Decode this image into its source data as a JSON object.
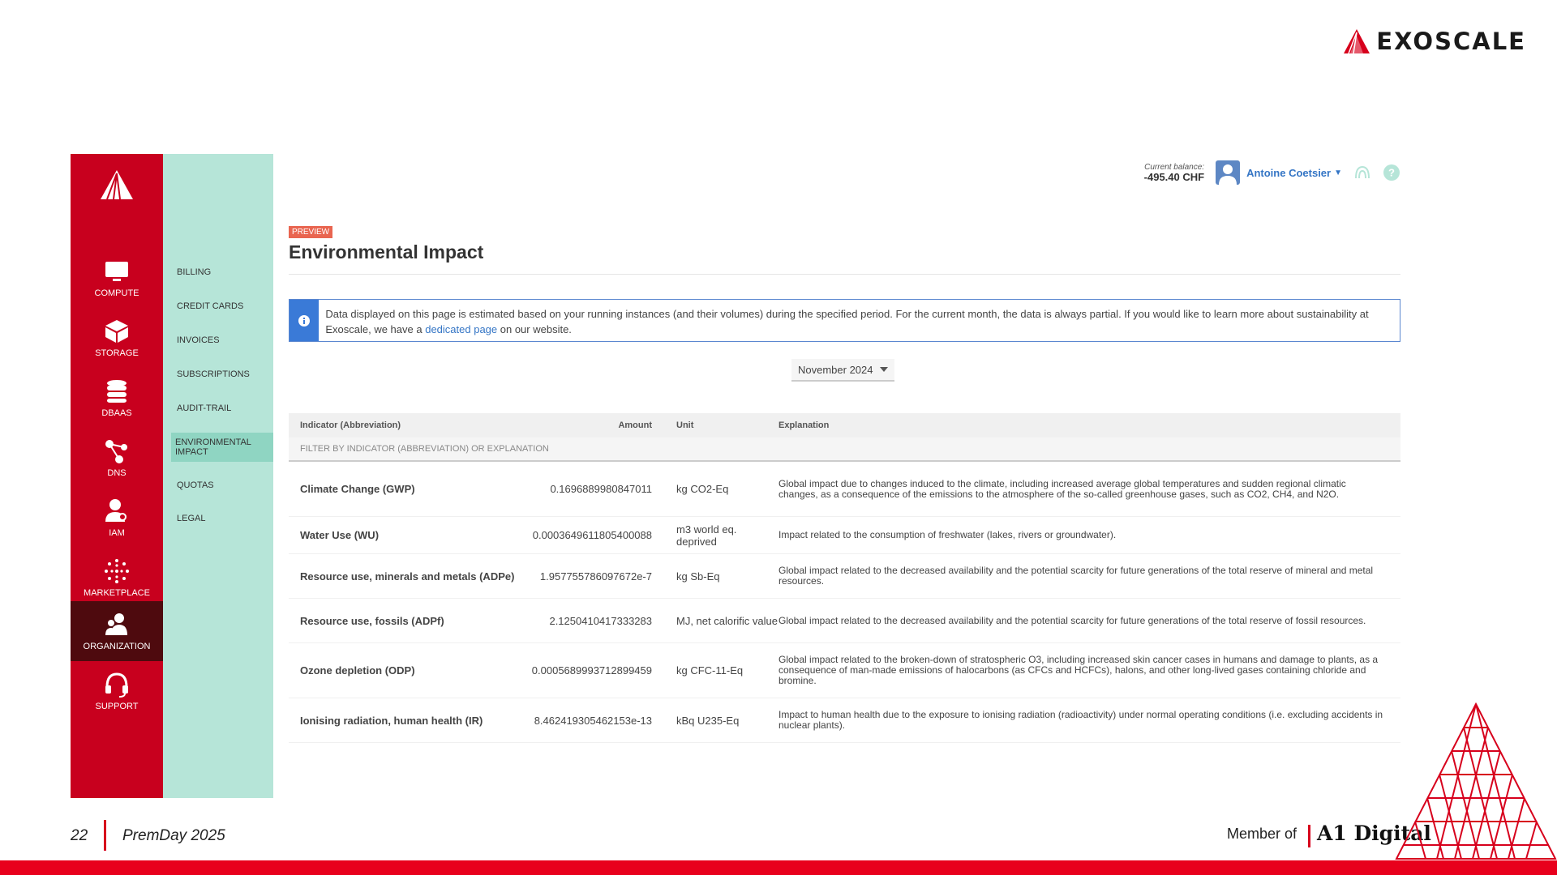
{
  "brand": {
    "name": "EXOSCALE"
  },
  "rail": {
    "items": [
      {
        "label": "COMPUTE",
        "icon": "monitor-icon"
      },
      {
        "label": "STORAGE",
        "icon": "cube-icon"
      },
      {
        "label": "DBAAS",
        "icon": "database-icon"
      },
      {
        "label": "DNS",
        "icon": "network-icon"
      },
      {
        "label": "IAM",
        "icon": "user-key-icon"
      },
      {
        "label": "MARKETPLACE",
        "icon": "dots-ring-icon"
      },
      {
        "label": "ORGANIZATION",
        "icon": "people-icon"
      },
      {
        "label": "SUPPORT",
        "icon": "headset-icon"
      }
    ],
    "active": "ORGANIZATION"
  },
  "subnav": {
    "items": [
      {
        "label": "BILLING"
      },
      {
        "label": "CREDIT CARDS"
      },
      {
        "label": "INVOICES"
      },
      {
        "label": "SUBSCRIPTIONS"
      },
      {
        "label": "AUDIT-TRAIL"
      },
      {
        "label": "ENVIRONMENTAL IMPACT"
      },
      {
        "label": "QUOTAS"
      },
      {
        "label": "LEGAL"
      }
    ],
    "active": "ENVIRONMENTAL IMPACT"
  },
  "topbar": {
    "balance_label": "Current balance:",
    "balance_value": "-495.40 CHF",
    "user_name": "Antoine Coetsier"
  },
  "page": {
    "badge": "PREVIEW",
    "title": "Environmental Impact",
    "info_text_before": "Data displayed on this page is estimated based on your running instances (and their volumes) during the specified period. For the current month, the data is always partial. If you would like to learn more about sustainability at Exoscale, we have a ",
    "info_link": "dedicated page",
    "info_text_after": " on our website.",
    "month": "November 2024"
  },
  "table": {
    "headers": {
      "indicator": "Indicator (Abbreviation)",
      "amount": "Amount",
      "unit": "Unit",
      "explanation": "Explanation"
    },
    "filter_placeholder": "FILTER BY INDICATOR (ABBREVIATION) OR EXPLANATION",
    "rows": [
      {
        "indicator": "Climate Change (GWP)",
        "amount": "0.1696889980847011",
        "unit": "kg CO2-Eq",
        "explanation": "Global impact due to changes induced to the climate, including increased average global temperatures and sudden regional climatic changes, as a consequence of the emissions to the atmosphere of the so-called greenhouse gases, such as CO2, CH4, and N2O."
      },
      {
        "indicator": "Water Use (WU)",
        "amount": "0.0003649611805400088",
        "unit": "m3 world eq. deprived",
        "explanation": "Impact related to the consumption of freshwater (lakes, rivers or groundwater)."
      },
      {
        "indicator": "Resource use, minerals and metals (ADPe)",
        "amount": "1.957755786097672e-7",
        "unit": "kg Sb-Eq",
        "explanation": "Global impact related to the decreased availability and the potential scarcity for future generations of the total reserve of mineral and metal resources."
      },
      {
        "indicator": "Resource use, fossils (ADPf)",
        "amount": "2.1250410417333283",
        "unit": "MJ, net calorific value",
        "explanation": "Global impact related to the decreased availability and the potential scarcity for future generations of the total reserve of fossil resources."
      },
      {
        "indicator": "Ozone depletion (ODP)",
        "amount": "0.0005689993712899459",
        "unit": "kg CFC-11-Eq",
        "explanation": "Global impact related to the broken-down of stratospheric O3, including increased skin cancer cases in humans and damage to plants, as a consequence of man-made emissions of halocarbons (as CFCs and HCFCs), halons, and other long-lived gases containing chloride and bromine."
      },
      {
        "indicator": "Ionising radiation, human health (IR)",
        "amount": "8.462419305462153e-13",
        "unit": "kBq U235-Eq",
        "explanation": "Impact to human health due to the exposure to ionising radiation (radioactivity) under normal operating conditions (i.e. excluding accidents in nuclear plants)."
      }
    ]
  },
  "footer": {
    "page_number": "22",
    "title": "PremDay 2025",
    "member_of": "Member of",
    "partner": "A1 Digital"
  },
  "colors": {
    "rail": "#c8001e",
    "rail_active": "#4e0a0e",
    "subnav": "#b6e5d8",
    "accent_blue": "#3a7ad7",
    "badge": "#e96550",
    "bottom_bar": "#e8001c"
  }
}
